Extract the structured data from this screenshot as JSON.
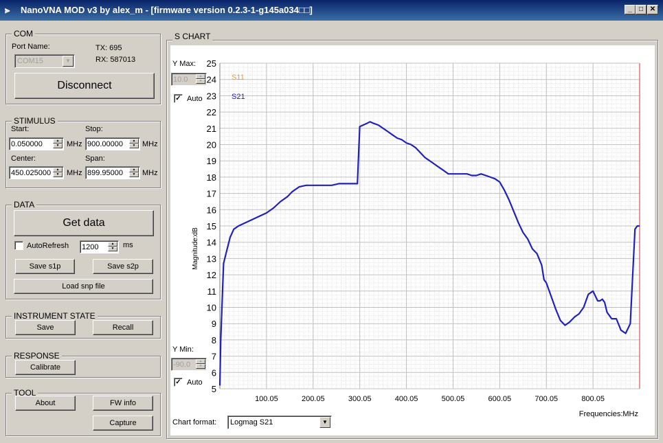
{
  "window": {
    "title": "NanoVNA MOD v3 by alex_m - [firmware version 0.2.3-1-g145a034□□]"
  },
  "com": {
    "label": "COM",
    "port_label": "Port Name:",
    "port_value": "COM15",
    "tx": "TX: 695",
    "rx": "RX: 587013",
    "disconnect": "Disconnect"
  },
  "stimulus": {
    "label": "STIMULUS",
    "start_label": "Start:",
    "start_value": "0.050000",
    "stop_label": "Stop:",
    "stop_value": "900.00000",
    "center_label": "Center:",
    "center_value": "450.025000",
    "span_label": "Span:",
    "span_value": "899.95000",
    "unit": "MHz"
  },
  "data": {
    "label": "DATA",
    "get_data": "Get data",
    "autorefresh": "AutoRefresh",
    "interval": "1200",
    "interval_unit": "ms",
    "save_s1p": "Save s1p",
    "save_s2p": "Save s2p",
    "load_snp": "Load snp file"
  },
  "instrument": {
    "label": "INSTRUMENT STATE",
    "save": "Save",
    "recall": "Recall"
  },
  "response": {
    "label": "RESPONSE",
    "calibrate": "Calibrate"
  },
  "tool": {
    "label": "TOOL",
    "about": "About",
    "fw_info": "FW info",
    "capture": "Capture"
  },
  "chart_panel": {
    "label": "S CHART",
    "ymax_label": "Y Max:",
    "ymax_value": "10.0",
    "ymin_label": "Y Min:",
    "ymin_value": "-90.0",
    "auto_label": "Auto",
    "format_label": "Chart format:",
    "format_value": "Logmag S21"
  },
  "colors": {
    "s11": "#e0a040",
    "s21": "#2020c0",
    "marker": "#e03030",
    "grid_major": "#c0c0c0",
    "grid_minor": "#e4e4e4"
  },
  "chart_data": {
    "type": "line",
    "ylabel": "Magnitude:dB",
    "xlabel": "Frequencies:MHz",
    "xlim": [
      0.05,
      900.0
    ],
    "ylim": [
      5,
      25
    ],
    "x_ticks": [
      "100.05",
      "200.05",
      "300.05",
      "400.05",
      "500.05",
      "600.05",
      "700.05",
      "800.05"
    ],
    "y_ticks": [
      "5",
      "6",
      "7",
      "8",
      "9",
      "10",
      "11",
      "12",
      "13",
      "14",
      "15",
      "16",
      "17",
      "18",
      "19",
      "20",
      "21",
      "22",
      "23",
      "24",
      "25"
    ],
    "legend": [
      "S11",
      "S21"
    ],
    "marker_x": 900.0,
    "series": [
      {
        "name": "S21",
        "x": [
          0.05,
          2,
          8,
          15,
          22,
          30,
          40,
          55,
          70,
          85,
          100,
          115,
          130,
          145,
          155,
          170,
          185,
          195,
          210,
          225,
          240,
          255,
          270,
          282,
          295,
          300,
          307,
          315,
          322,
          330,
          340,
          350,
          360,
          370,
          380,
          390,
          400,
          410,
          420,
          430,
          440,
          450,
          460,
          470,
          480,
          490,
          500,
          510,
          520,
          530,
          540,
          550,
          560,
          570,
          580,
          590,
          600,
          610,
          620,
          630,
          640,
          650,
          660,
          670,
          680,
          690,
          695,
          700,
          710,
          720,
          730,
          740,
          750,
          760,
          770,
          780,
          785,
          790,
          800,
          805,
          810,
          815,
          820,
          825,
          830,
          840,
          850,
          860,
          870,
          880,
          890,
          895,
          900
        ],
        "y": [
          5.2,
          8.0,
          12.7,
          13.5,
          14.3,
          14.8,
          15.0,
          15.2,
          15.4,
          15.6,
          15.8,
          16.1,
          16.5,
          16.8,
          17.1,
          17.4,
          17.5,
          17.5,
          17.5,
          17.5,
          17.5,
          17.6,
          17.6,
          17.6,
          17.6,
          21.1,
          21.2,
          21.3,
          21.4,
          21.3,
          21.2,
          21.0,
          20.8,
          20.6,
          20.4,
          20.3,
          20.1,
          20.0,
          19.8,
          19.5,
          19.2,
          19.0,
          18.8,
          18.6,
          18.4,
          18.2,
          18.2,
          18.2,
          18.2,
          18.2,
          18.1,
          18.1,
          18.2,
          18.1,
          18.0,
          17.9,
          17.7,
          17.2,
          16.6,
          15.9,
          15.2,
          14.6,
          14.2,
          13.6,
          13.3,
          12.6,
          11.7,
          11.5,
          10.7,
          9.9,
          9.2,
          8.9,
          9.1,
          9.4,
          9.6,
          10.0,
          10.4,
          10.8,
          11.0,
          10.7,
          10.4,
          10.4,
          10.5,
          10.3,
          9.7,
          9.3,
          9.3,
          8.6,
          8.4,
          9.0,
          14.8,
          15.0,
          15.0
        ]
      }
    ]
  }
}
